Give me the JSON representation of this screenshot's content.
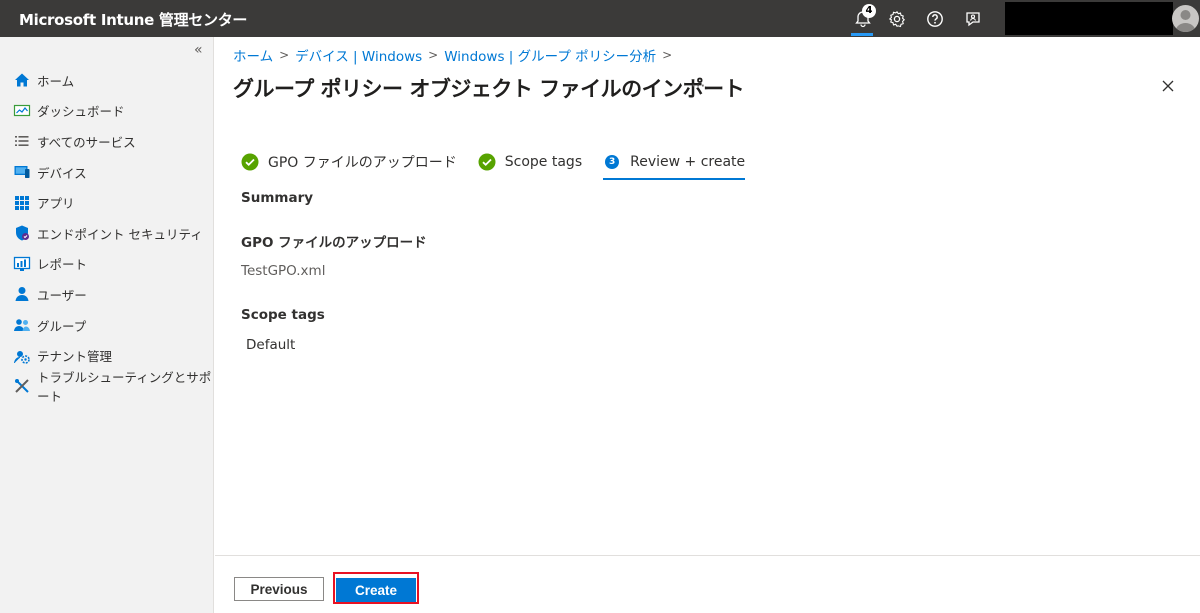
{
  "app": {
    "title": "Microsoft Intune 管理センター"
  },
  "header": {
    "notification_count": "4"
  },
  "sidebar": {
    "collapse_label": "«",
    "items": [
      {
        "label": "ホーム",
        "icon": "home-icon"
      },
      {
        "label": "ダッシュボード",
        "icon": "dashboard-icon"
      },
      {
        "label": "すべてのサービス",
        "icon": "list-icon"
      },
      {
        "label": "デバイス",
        "icon": "device-icon"
      },
      {
        "label": "アプリ",
        "icon": "apps-grid-icon"
      },
      {
        "label": "エンドポイント セキュリティ",
        "icon": "shield-icon"
      },
      {
        "label": "レポート",
        "icon": "report-icon"
      },
      {
        "label": "ユーザー",
        "icon": "user-icon"
      },
      {
        "label": "グループ",
        "icon": "group-icon"
      },
      {
        "label": "テナント管理",
        "icon": "tenant-gear-icon"
      },
      {
        "label": "トラブルシューティングとサポート",
        "icon": "wrench-icon"
      }
    ]
  },
  "breadcrumb": {
    "items": [
      "ホーム",
      "デバイス | Windows",
      "Windows | グループ ポリシー分析"
    ]
  },
  "page": {
    "title": "グループ ポリシー オブジェクト ファイルのインポート",
    "more_label": "···"
  },
  "wizard": {
    "steps": [
      {
        "label": "GPO ファイルのアップロード",
        "state": "done"
      },
      {
        "label": "Scope tags",
        "state": "done"
      },
      {
        "label": "Review + create",
        "state": "active",
        "number": "3"
      }
    ]
  },
  "summary": {
    "heading": "Summary",
    "sections": [
      {
        "title": "GPO ファイルのアップロード",
        "value": "TestGPO.xml"
      },
      {
        "title": "Scope tags",
        "value": "Default"
      }
    ]
  },
  "footer": {
    "previous_label": "Previous",
    "create_label": "Create"
  },
  "colors": {
    "accent": "#0078d4",
    "success": "#57a300",
    "topbar": "#3b3a39",
    "highlight": "#e81123"
  }
}
